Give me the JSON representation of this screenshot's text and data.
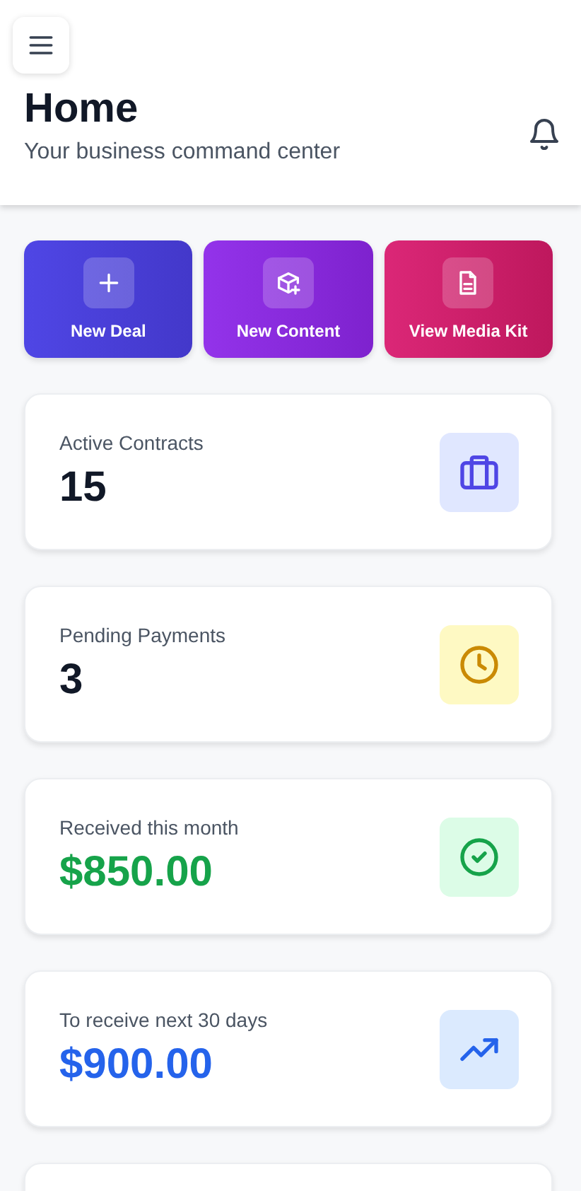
{
  "header": {
    "title": "Home",
    "subtitle": "Your business command center"
  },
  "actions": [
    {
      "label": "New Deal",
      "kind": "plus"
    },
    {
      "label": "New Content",
      "kind": "box"
    },
    {
      "label": "View Media Kit",
      "kind": "doc"
    }
  ],
  "stats": [
    {
      "label": "Active Contracts",
      "value": "15",
      "kind": "briefcase",
      "color": "#111827"
    },
    {
      "label": "Pending Payments",
      "value": "3",
      "kind": "clock",
      "color": "#111827"
    },
    {
      "label": "Received this month",
      "value": "$850.00",
      "kind": "check",
      "color": "#16a34a"
    },
    {
      "label": "To receive next 30 days",
      "value": "$900.00",
      "kind": "trend",
      "color": "#2563eb"
    }
  ]
}
